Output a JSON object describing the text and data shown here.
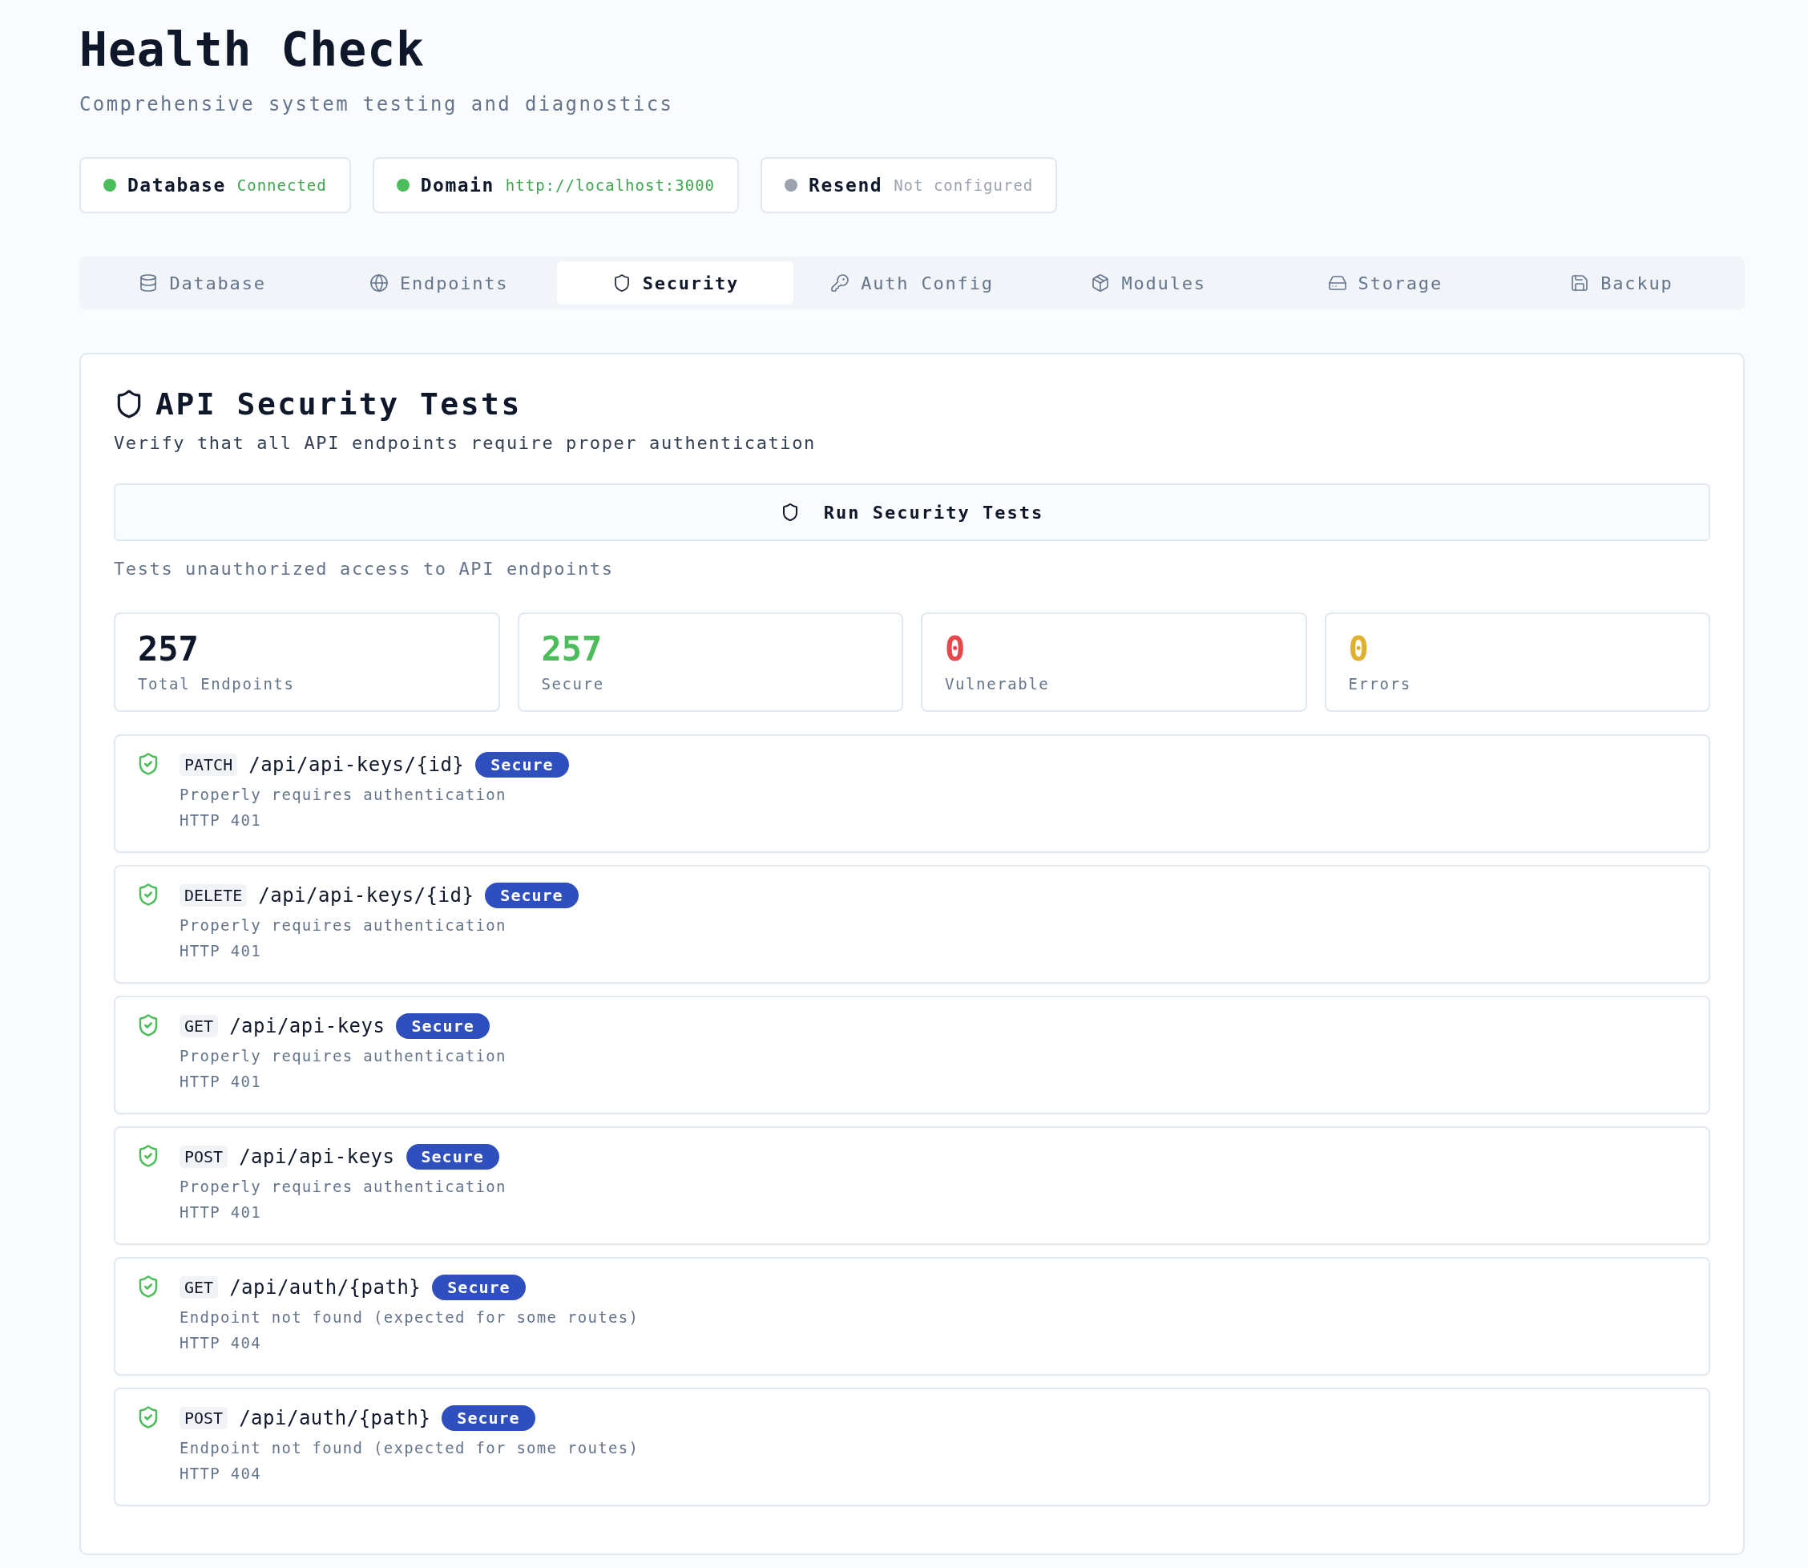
{
  "page": {
    "title": "Health Check",
    "subtitle": "Comprehensive system testing and diagnostics"
  },
  "services": [
    {
      "name": "Database",
      "status": "Connected",
      "color": "#4dbd5c"
    },
    {
      "name": "Domain",
      "status": "http://localhost:3000",
      "color": "#4dbd5c"
    },
    {
      "name": "Resend",
      "status": "Not configured",
      "color": "#9ca3af"
    }
  ],
  "tabs": [
    {
      "label": "Database",
      "selected": false
    },
    {
      "label": "Endpoints",
      "selected": false
    },
    {
      "label": "Security",
      "selected": true
    },
    {
      "label": "Auth Config",
      "selected": false
    },
    {
      "label": "Modules",
      "selected": false
    },
    {
      "label": "Storage",
      "selected": false
    },
    {
      "label": "Backup",
      "selected": false
    }
  ],
  "panel": {
    "title": "API Security Tests",
    "description": "Verify that all API endpoints require proper authentication",
    "run_button": "Run Security Tests",
    "run_hint": "Tests unauthorized access to API endpoints",
    "stats": [
      {
        "value": "257",
        "label": "Total Endpoints",
        "color": "#0f172a"
      },
      {
        "value": "257",
        "label": "Secure",
        "color": "#4dbd5c"
      },
      {
        "value": "0",
        "label": "Vulnerable",
        "color": "#e5484d"
      },
      {
        "value": "0",
        "label": "Errors",
        "color": "#e0b030"
      }
    ],
    "results": [
      {
        "method": "PATCH",
        "path": "/api/api-keys/{id}",
        "badge": "Secure",
        "message": "Properly requires authentication",
        "code": "HTTP 401"
      },
      {
        "method": "DELETE",
        "path": "/api/api-keys/{id}",
        "badge": "Secure",
        "message": "Properly requires authentication",
        "code": "HTTP 401"
      },
      {
        "method": "GET",
        "path": "/api/api-keys",
        "badge": "Secure",
        "message": "Properly requires authentication",
        "code": "HTTP 401"
      },
      {
        "method": "POST",
        "path": "/api/api-keys",
        "badge": "Secure",
        "message": "Properly requires authentication",
        "code": "HTTP 401"
      },
      {
        "method": "GET",
        "path": "/api/auth/{path}",
        "badge": "Secure",
        "message": "Endpoint not found (expected for some routes)",
        "code": "HTTP 404"
      },
      {
        "method": "POST",
        "path": "/api/auth/{path}",
        "badge": "Secure",
        "message": "Endpoint not found (expected for some routes)",
        "code": "HTTP 404"
      }
    ]
  }
}
